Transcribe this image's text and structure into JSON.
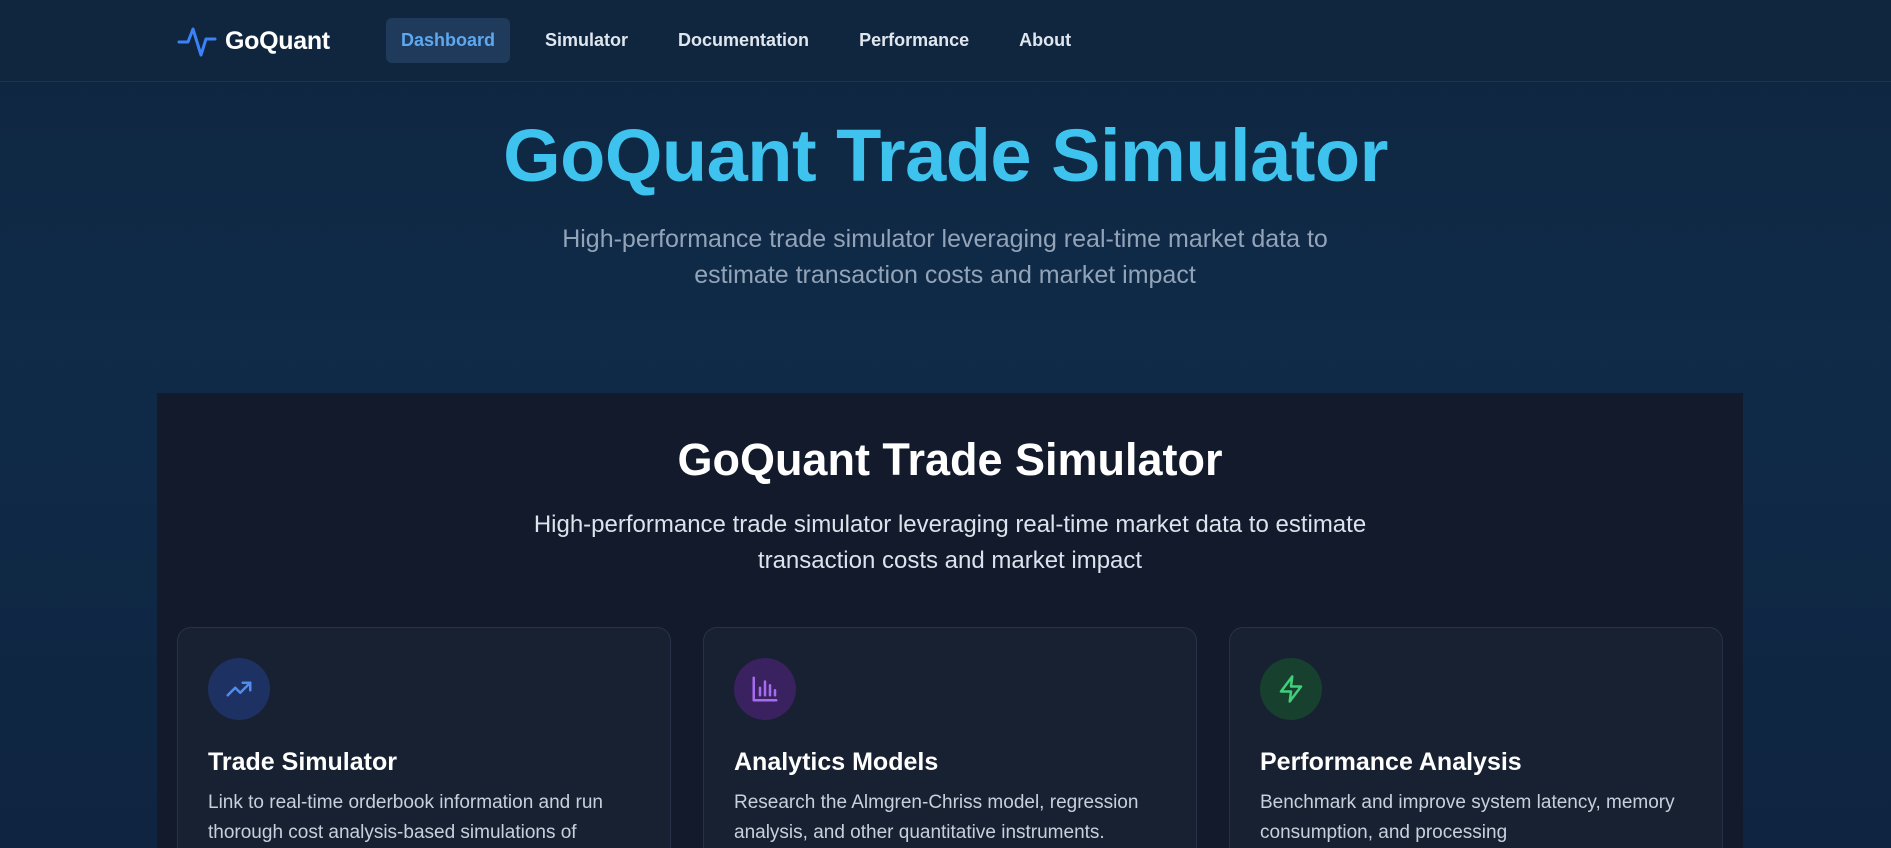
{
  "navbar": {
    "brand": "GoQuant",
    "brand_icon": "activity-pulse-icon",
    "links": [
      {
        "label": "Dashboard",
        "active": true
      },
      {
        "label": "Simulator",
        "active": false
      },
      {
        "label": "Documentation",
        "active": false
      },
      {
        "label": "Performance",
        "active": false
      },
      {
        "label": "About",
        "active": false
      }
    ]
  },
  "hero": {
    "title": "GoQuant Trade Simulator",
    "subtitle": "High-performance trade simulator leveraging real-time market data to estimate transaction costs and market impact"
  },
  "panel": {
    "title": "GoQuant Trade Simulator",
    "subtitle": "High-performance trade simulator leveraging real-time market data to estimate transaction costs and market impact",
    "cards": [
      {
        "icon": "trending-up-icon",
        "icon_color": "#4f8cf0",
        "icon_bg": "#1e3163",
        "title": "Trade Simulator",
        "description": "Link to real-time orderbook information and run thorough cost analysis-based simulations of"
      },
      {
        "icon": "bar-chart-icon",
        "icon_color": "#a66cf0",
        "icon_bg": "#3a2160",
        "title": "Analytics Models",
        "description": "Research the Almgren-Chriss model, regression analysis, and other quantitative instruments."
      },
      {
        "icon": "zap-icon",
        "icon_color": "#3fd079",
        "icon_bg": "#17402e",
        "title": "Performance Analysis",
        "description": "Benchmark and improve system latency, memory consumption, and processing"
      }
    ]
  },
  "colors": {
    "accent": "#3ec3ef",
    "active_link": "#5ea8f0"
  }
}
